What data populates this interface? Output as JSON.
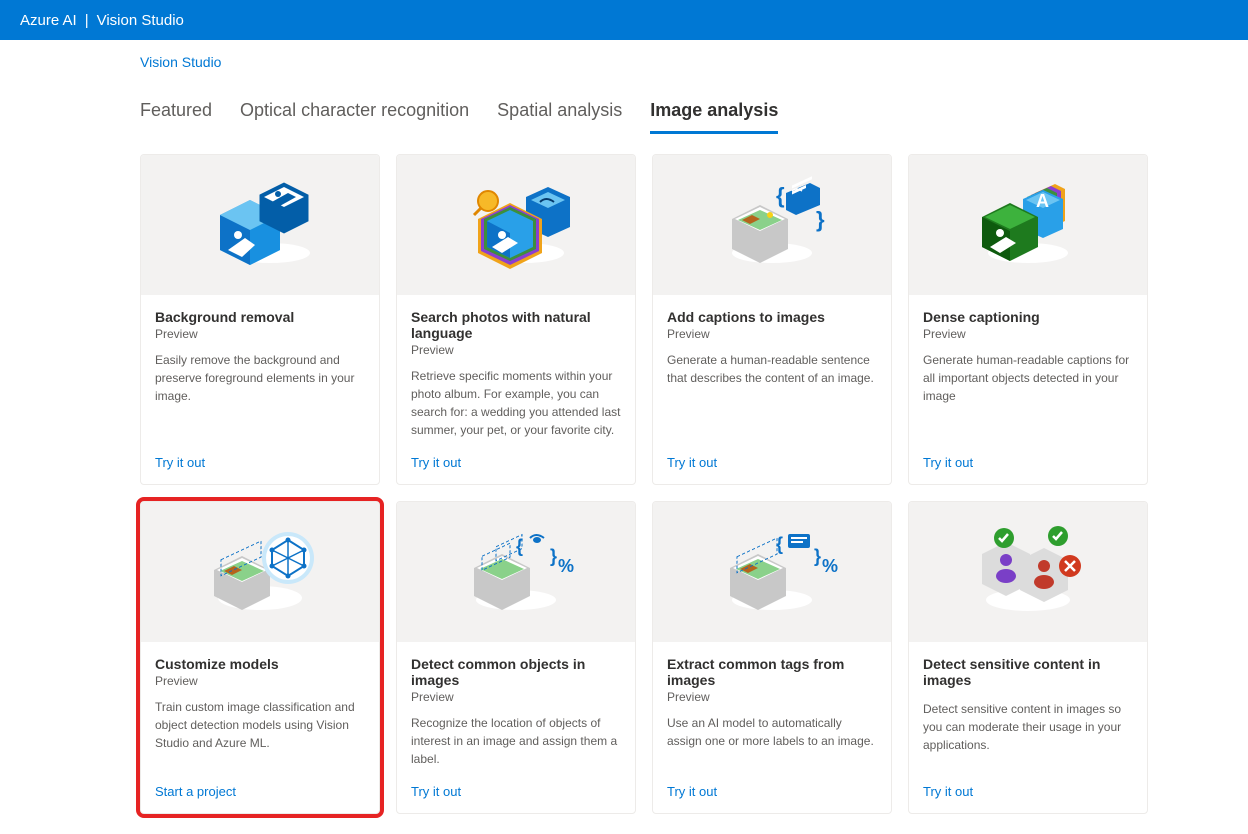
{
  "header": {
    "brand": "Azure AI",
    "product": "Vision Studio"
  },
  "breadcrumb": "Vision Studio",
  "tabs": [
    {
      "label": "Featured",
      "active": false
    },
    {
      "label": "Optical character recognition",
      "active": false
    },
    {
      "label": "Spatial analysis",
      "active": false
    },
    {
      "label": "Image analysis",
      "active": true
    }
  ],
  "cards": [
    {
      "title": "Background removal",
      "sub": "Preview",
      "desc": "Easily remove the background and preserve foreground elements in your image.",
      "link": "Try it out",
      "highlight": false
    },
    {
      "title": "Search photos with natural language",
      "sub": "Preview",
      "desc": "Retrieve specific moments within your photo album. For example, you can search for: a wedding you attended last summer, your pet, or your favorite city.",
      "link": "Try it out",
      "highlight": false
    },
    {
      "title": "Add captions to images",
      "sub": "Preview",
      "desc": "Generate a human-readable sentence that describes the content of an image.",
      "link": "Try it out",
      "highlight": false
    },
    {
      "title": "Dense captioning",
      "sub": "Preview",
      "desc": "Generate human-readable captions for all important objects detected in your image",
      "link": "Try it out",
      "highlight": false
    },
    {
      "title": "Customize models",
      "sub": "Preview",
      "desc": "Train custom image classification and object detection models using Vision Studio and Azure ML.",
      "link": "Start a project",
      "highlight": true
    },
    {
      "title": "Detect common objects in images",
      "sub": "Preview",
      "desc": "Recognize the location of objects of interest in an image and assign them a label.",
      "link": "Try it out",
      "highlight": false
    },
    {
      "title": "Extract common tags from images",
      "sub": "Preview",
      "desc": "Use an AI model to automatically assign one or more labels to an image.",
      "link": "Try it out",
      "highlight": false
    },
    {
      "title": "Detect sensitive content in images",
      "sub": "",
      "desc": "Detect sensitive content in images so you can moderate their usage in your applications.",
      "link": "Try it out",
      "highlight": false
    }
  ]
}
